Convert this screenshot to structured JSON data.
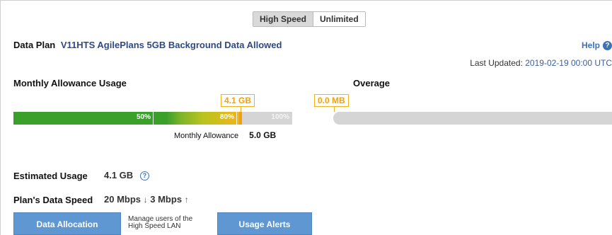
{
  "tabs": [
    {
      "label": "High Speed",
      "active": true
    },
    {
      "label": "Unlimited",
      "active": false
    }
  ],
  "plan": {
    "label": "Data Plan",
    "name": "V11HTS AgilePlans 5GB Background Data Allowed"
  },
  "help": {
    "label": "Help",
    "icon": "help-icon"
  },
  "last_updated": {
    "label": "Last Updated:",
    "value": "2019-02-19 00:00 UTC"
  },
  "monthly": {
    "title": "Monthly Allowance Usage",
    "used_label": "4.1 GB",
    "used_fraction": 0.82,
    "ticks": [
      "50%",
      "80%",
      "100%"
    ],
    "allowance_label": "Monthly Allowance",
    "allowance_value": "5.0 GB"
  },
  "overage": {
    "title": "Overage",
    "used_label": "0.0 MB",
    "used_fraction": 0
  },
  "estimated": {
    "label": "Estimated Usage",
    "value": "4.1 GB",
    "icon": "question-circle-icon"
  },
  "speed": {
    "label": "Plan's Data Speed",
    "down": "20 Mbps",
    "down_arrow": "↓",
    "up": "3 Mbps",
    "up_arrow": "↑"
  },
  "buttons": {
    "data_allocation": "Data Allocation",
    "manage_note_line1": "Manage users of the",
    "manage_note_line2": "High Speed LAN",
    "usage_alerts": "Usage Alerts"
  },
  "colors": {
    "accent": "#3b73b9",
    "usage_green": "#3aa02a",
    "usage_orange": "#f0a20c",
    "bar_empty": "#d5d5d5",
    "button_blue": "#5f97d2"
  }
}
